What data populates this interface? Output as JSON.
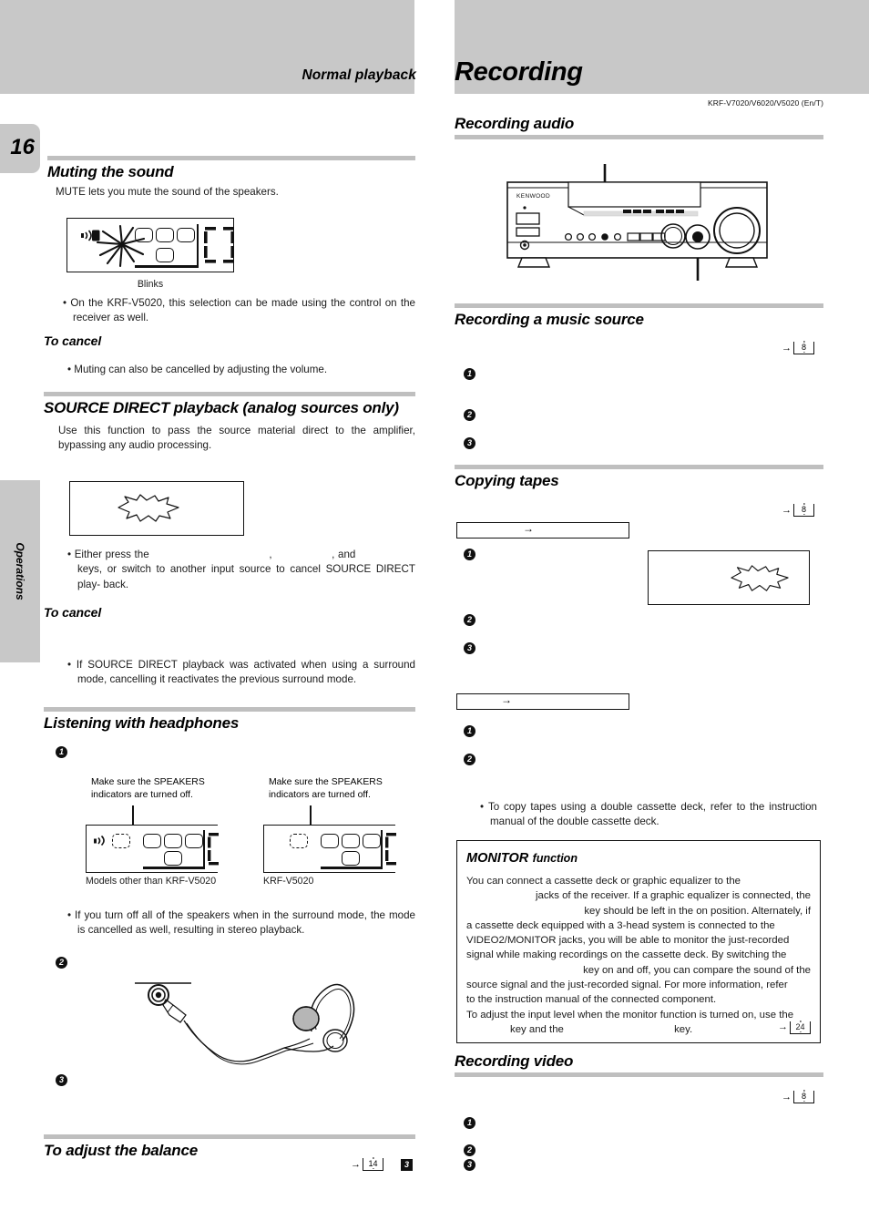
{
  "document": {
    "running_head": "Normal playback",
    "chapter_title": "Recording",
    "model_line": "KRF-V7020/V6020/V5020 (En/T)",
    "page_number": "16",
    "section_tab": "Operations"
  },
  "left_column": {
    "muting": {
      "heading": "Muting the sound",
      "intro": "MUTE lets you mute the sound of the speakers.",
      "display_caption": "Blinks",
      "note": "On the KRF-V5020, this selection can be made using the control on the receiver as well.",
      "to_cancel_heading": "To cancel",
      "to_cancel_note": "Muting can also be cancelled by adjusting the volume."
    },
    "source_direct": {
      "heading": "SOURCE DIRECT playback (analog sources only)",
      "intro": "Use this function to pass the source material direct to the amplifier, bypassing any audio processing.",
      "note_part1": "Either press the",
      "note_comma1": ",",
      "note_comma2": ", and",
      "note_part2": "keys, or switch to another input source to cancel SOURCE DIRECT play-",
      "note_part3": "back.",
      "to_cancel_heading": "To cancel",
      "to_cancel_note": "If SOURCE DIRECT playback was activated when using a surround mode, cancelling it reactivates the previous surround mode."
    },
    "headphones": {
      "heading": "Listening with headphones",
      "step1": "1",
      "step2": "2",
      "step3": "3",
      "callout_left": "Make sure the SPEAKERS indicators are turned off.",
      "callout_right": "Make sure the SPEAKERS indicators are turned off.",
      "label_left": "Models other than KRF-V5020",
      "label_right": "KRF-V5020",
      "note": "If you turn off all of the speakers when in the surround mode, the mode is cancelled as well, resulting in stereo playback."
    },
    "balance": {
      "heading": "To adjust the balance",
      "pageref": "14",
      "step_marker": "3"
    }
  },
  "right_column": {
    "recording_audio": {
      "heading": "Recording audio"
    },
    "music_source": {
      "heading": "Recording a music source",
      "pageref": "8",
      "step1": "1",
      "step2": "2",
      "step3": "3"
    },
    "copying_tapes": {
      "heading": "Copying tapes",
      "pageref": "8",
      "box1_arrow": "→",
      "box2_arrow": "→",
      "step1": "1",
      "step2": "2",
      "step3": "3",
      "step4": "1",
      "step5": "2",
      "note": "To copy tapes using a double cassette deck, refer to the instruction manual of the double cassette deck."
    },
    "monitor": {
      "heading_bold": "MONITOR",
      "heading_rest": "function",
      "line1": "You can connect a cassette deck or graphic equalizer to the",
      "line2": "jacks of the receiver. If a graphic equalizer is connected, the",
      "line3": "key should be left in the on position. Alternately, if",
      "line4": "a cassette deck equipped with a 3-head system is connected to the",
      "line5": "VIDEO2/MONITOR jacks, you will be able to monitor the just-recorded",
      "line6": "signal while making recordings on the cassette deck. By switching the",
      "line7": "key on and off, you can compare the sound of the",
      "line8": "source signal and the just-recorded signal. For more information, refer",
      "line9": "to the instruction manual of the connected component.",
      "line10": "To adjust the input level when the monitor function is turned on, use the",
      "line11_a": "key and the",
      "line11_b": "key.",
      "pageref": "24"
    },
    "recording_video": {
      "heading": "Recording video",
      "pageref": "8",
      "step1": "1",
      "step2": "2",
      "step3": "3"
    }
  },
  "receiver_illustration": {
    "brand": "KENWOOD"
  },
  "colors": {
    "band_grey": "#c8c8c8",
    "rule_grey": "#bfbfbf",
    "ink": "#000000"
  }
}
